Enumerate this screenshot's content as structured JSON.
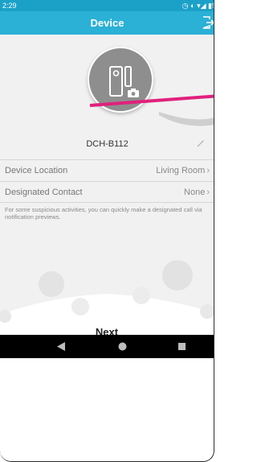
{
  "status_bar": {
    "time": "2:29",
    "icons": "◷ ◐ ▾◢ ▮97"
  },
  "header": {
    "title": "Device",
    "exit_icon": "exit-icon"
  },
  "device": {
    "name": "DCH-B112",
    "photo_icon": "camera-icon",
    "edit_icon": "pencil-icon"
  },
  "rows": [
    {
      "label": "Device Location",
      "value": "Living Room"
    },
    {
      "label": "Designated Contact",
      "value": "None"
    }
  ],
  "hint": "For some suspicious activities, you can quickly make a designated call via notification previews.",
  "next_label": "Next",
  "colors": {
    "header": "#2bb0d6",
    "status_bar": "#1ba1c8",
    "annotation_line": "#e0217d"
  }
}
